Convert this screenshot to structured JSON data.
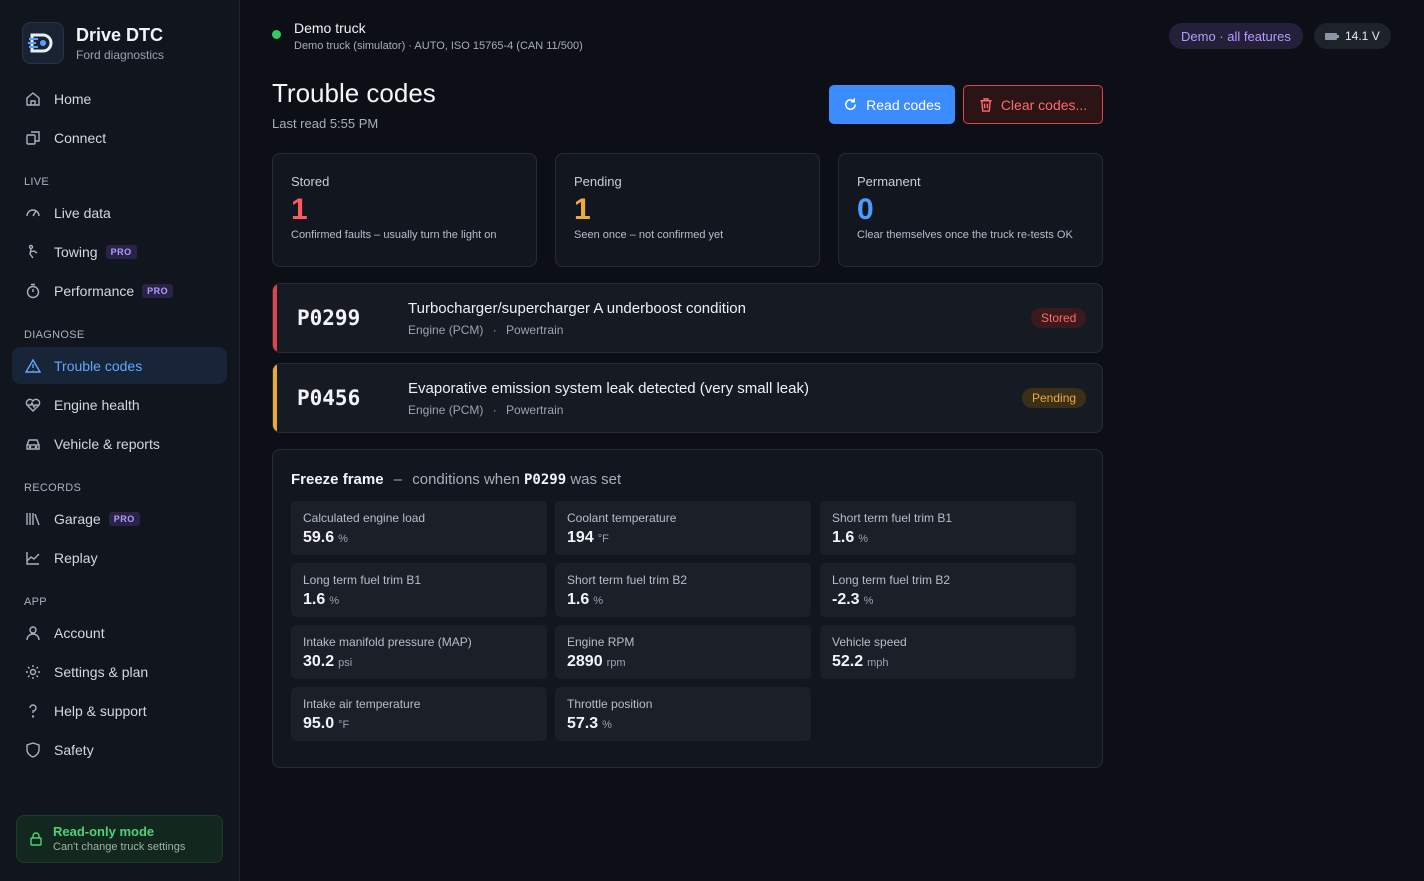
{
  "brand": {
    "title": "Drive DTC",
    "subtitle": "Ford diagnostics"
  },
  "nav": {
    "home": "Home",
    "connect": "Connect",
    "section_live": "LIVE",
    "live_data": "Live data",
    "towing": "Towing",
    "performance": "Performance",
    "section_diagnose": "DIAGNOSE",
    "trouble_codes": "Trouble codes",
    "engine_health": "Engine health",
    "vehicle_reports": "Vehicle & reports",
    "section_records": "RECORDS",
    "garage": "Garage",
    "replay": "Replay",
    "section_app": "APP",
    "account": "Account",
    "settings": "Settings & plan",
    "help": "Help & support",
    "safety": "Safety",
    "pro_badge": "PRO"
  },
  "readonly": {
    "title": "Read-only mode",
    "subtitle": "Can't change truck settings"
  },
  "vehicle": {
    "name": "Demo truck",
    "detail": "Demo truck (simulator) · AUTO, ISO 15765-4 (CAN 11/500)"
  },
  "top": {
    "demo_label": "Demo · all features",
    "voltage": "14.1 V"
  },
  "page": {
    "title": "Trouble codes",
    "last_read": "Last read 5:55 PM"
  },
  "actions": {
    "read": "Read codes",
    "clear": "Clear codes..."
  },
  "stats": [
    {
      "label": "Stored",
      "value": "1",
      "desc": "Confirmed faults – usually turn the light on",
      "color": "#ff5a5a"
    },
    {
      "label": "Pending",
      "value": "1",
      "desc": "Seen once – not confirmed yet",
      "color": "#f2a93b"
    },
    {
      "label": "Permanent",
      "value": "0",
      "desc": "Clear themselves once the truck re-tests OK",
      "color": "#4a9dff"
    }
  ],
  "codes": [
    {
      "code": "P0299",
      "title": "Turbocharger/supercharger A underboost condition",
      "module": "Engine (PCM)",
      "sep": "·",
      "system": "Powertrain",
      "status": "Stored",
      "color": "#e0444a"
    },
    {
      "code": "P0456",
      "title": "Evaporative emission system leak detected (very small leak)",
      "module": "Engine (PCM)",
      "sep": "·",
      "system": "Powertrain",
      "status": "Pending",
      "color": "#e8a93a"
    }
  ],
  "freeze": {
    "title": "Freeze frame",
    "dash": "–",
    "prefix": "conditions when",
    "code": "P0299",
    "suffix": "was set",
    "items": [
      {
        "label": "Calculated engine load",
        "value": "59.6",
        "unit": "%"
      },
      {
        "label": "Coolant temperature",
        "value": "194",
        "unit": "°F"
      },
      {
        "label": "Short term fuel trim B1",
        "value": "1.6",
        "unit": "%"
      },
      {
        "label": "Long term fuel trim B1",
        "value": "1.6",
        "unit": "%"
      },
      {
        "label": "Short term fuel trim B2",
        "value": "1.6",
        "unit": "%"
      },
      {
        "label": "Long term fuel trim B2",
        "value": "-2.3",
        "unit": "%"
      },
      {
        "label": "Intake manifold pressure (MAP)",
        "value": "30.2",
        "unit": "psi"
      },
      {
        "label": "Engine RPM",
        "value": "2890",
        "unit": "rpm"
      },
      {
        "label": "Vehicle speed",
        "value": "52.2",
        "unit": "mph"
      },
      {
        "label": "Intake air temperature",
        "value": "95.0",
        "unit": "°F"
      },
      {
        "label": "Throttle position",
        "value": "57.3",
        "unit": "%"
      }
    ]
  }
}
